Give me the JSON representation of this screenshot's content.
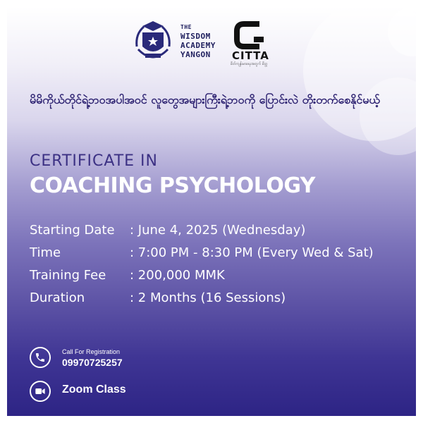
{
  "brand": {
    "academy_line1": "THE",
    "academy_line2": "WISDOM",
    "academy_line3": "ACADEMY",
    "academy_line4": "YANGON",
    "citta_name": "CITTA",
    "citta_tagline": "စိတ်ကျန်းမာရေးအတွက် စိတ္တ"
  },
  "tagline": "မိမိကိုယ်တိုင်ရဲ့ဘဝအပါအဝင် လူတွေအများကြီးရဲ့ဘဝကို ပြောင်းလဲ တိုးတက်စေနိုင်မယ့်",
  "heading": {
    "pre": "CERTIFICATE IN",
    "title": "COACHING PSYCHOLOGY"
  },
  "details": [
    {
      "label": "Starting Date",
      "value": ": June 4, 2025 (Wednesday)"
    },
    {
      "label": "Time",
      "value": ": 7:00 PM - 8:30 PM (Every Wed & Sat)"
    },
    {
      "label": "Training Fee",
      "value": ": 200,000 MMK"
    },
    {
      "label": "Duration",
      "value": ": 2 Months (16 Sessions)"
    }
  ],
  "contact": {
    "call_label": "Call For Registration",
    "phone": "09970725257",
    "zoom": "Zoom Class",
    "phone_icon": "phone-icon",
    "zoom_icon": "video-camera-icon"
  },
  "colors": {
    "deep_purple": "#2d2485",
    "heading_purple": "#3c3184",
    "white": "#ffffff"
  }
}
